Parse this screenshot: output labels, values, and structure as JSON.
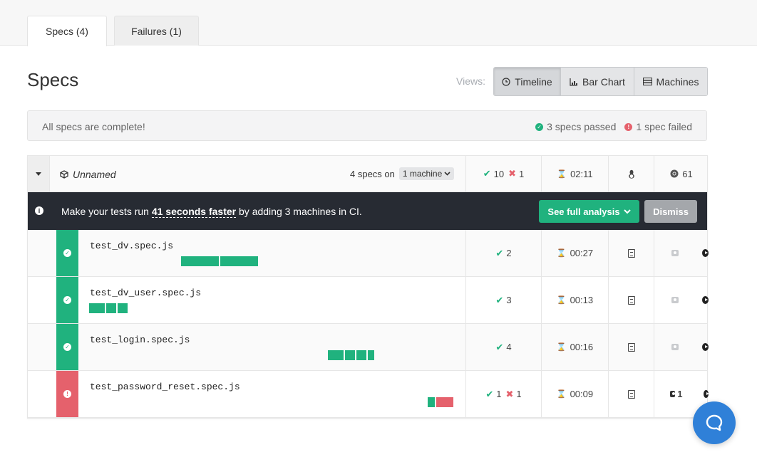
{
  "tabs": [
    {
      "label": "Specs (4)",
      "active": true
    },
    {
      "label": "Failures (1)",
      "active": false
    }
  ],
  "page_title": "Specs",
  "views": {
    "label": "Views:",
    "timeline": "Timeline",
    "bar_chart": "Bar Chart",
    "machines": "Machines",
    "active": "Timeline"
  },
  "status": {
    "message": "All specs are complete!",
    "passed": "3 specs passed",
    "failed": "1 spec failed"
  },
  "group": {
    "name": "Unnamed",
    "specs_on": "4 specs on",
    "machine_select": "1 machine",
    "passed": "10",
    "failed": "1",
    "duration": "02:11",
    "browser_version": "61"
  },
  "banner": {
    "prefix": "Make your tests run ",
    "highlight": "41 seconds faster",
    "suffix": " by adding 3 machines in CI.",
    "analysis_button": "See full analysis",
    "dismiss_button": "Dismiss"
  },
  "specs": [
    {
      "name": "test_dv.spec.js",
      "status": "passed",
      "passed": "2",
      "failed": "",
      "duration": "00:27",
      "screenshots": ""
    },
    {
      "name": "test_dv_user.spec.js",
      "status": "passed",
      "passed": "3",
      "failed": "",
      "duration": "00:13",
      "screenshots": ""
    },
    {
      "name": "test_login.spec.js",
      "status": "passed",
      "passed": "4",
      "failed": "",
      "duration": "00:16",
      "screenshots": ""
    },
    {
      "name": "test_password_reset.spec.js",
      "status": "failed",
      "passed": "1",
      "failed": "1",
      "duration": "00:09",
      "screenshots": "1"
    }
  ],
  "colors": {
    "pass": "#20b27e",
    "fail": "#e5616c",
    "banner_bg": "#272b33",
    "chat": "#2f80d8"
  }
}
